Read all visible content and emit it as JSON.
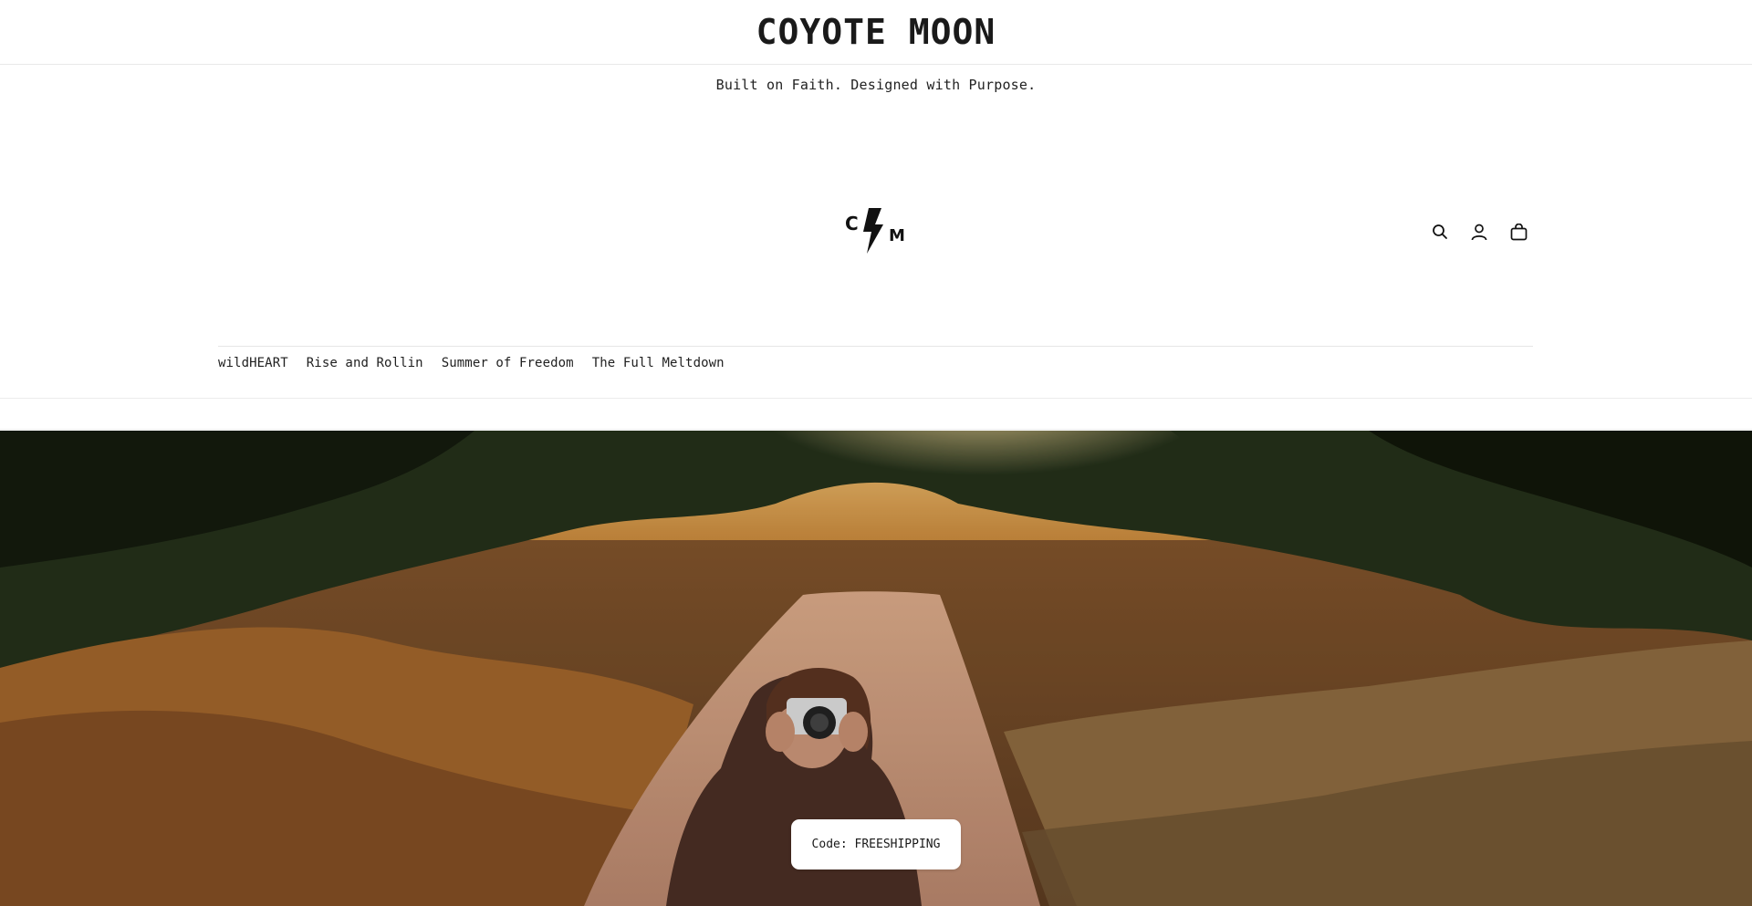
{
  "header": {
    "site_title": "COYOTE MOON",
    "tagline": "Built on Faith. Designed with Purpose.",
    "logo_icon": "cm-lightning-logo",
    "icons": [
      "search-icon",
      "account-icon",
      "cart-icon"
    ]
  },
  "nav": {
    "items": [
      {
        "label": "wildHEART"
      },
      {
        "label": "Rise and Rollin"
      },
      {
        "label": "Summer of Freedom"
      },
      {
        "label": "The Full Meltdown"
      }
    ]
  },
  "hero": {
    "image": "girl-with-camera-on-dirt-path-at-sunset",
    "badge_text": "Code: FREESHIPPING"
  },
  "colors": {
    "text": "#121212",
    "background": "#ffffff",
    "divider": "#e8e8e8"
  }
}
